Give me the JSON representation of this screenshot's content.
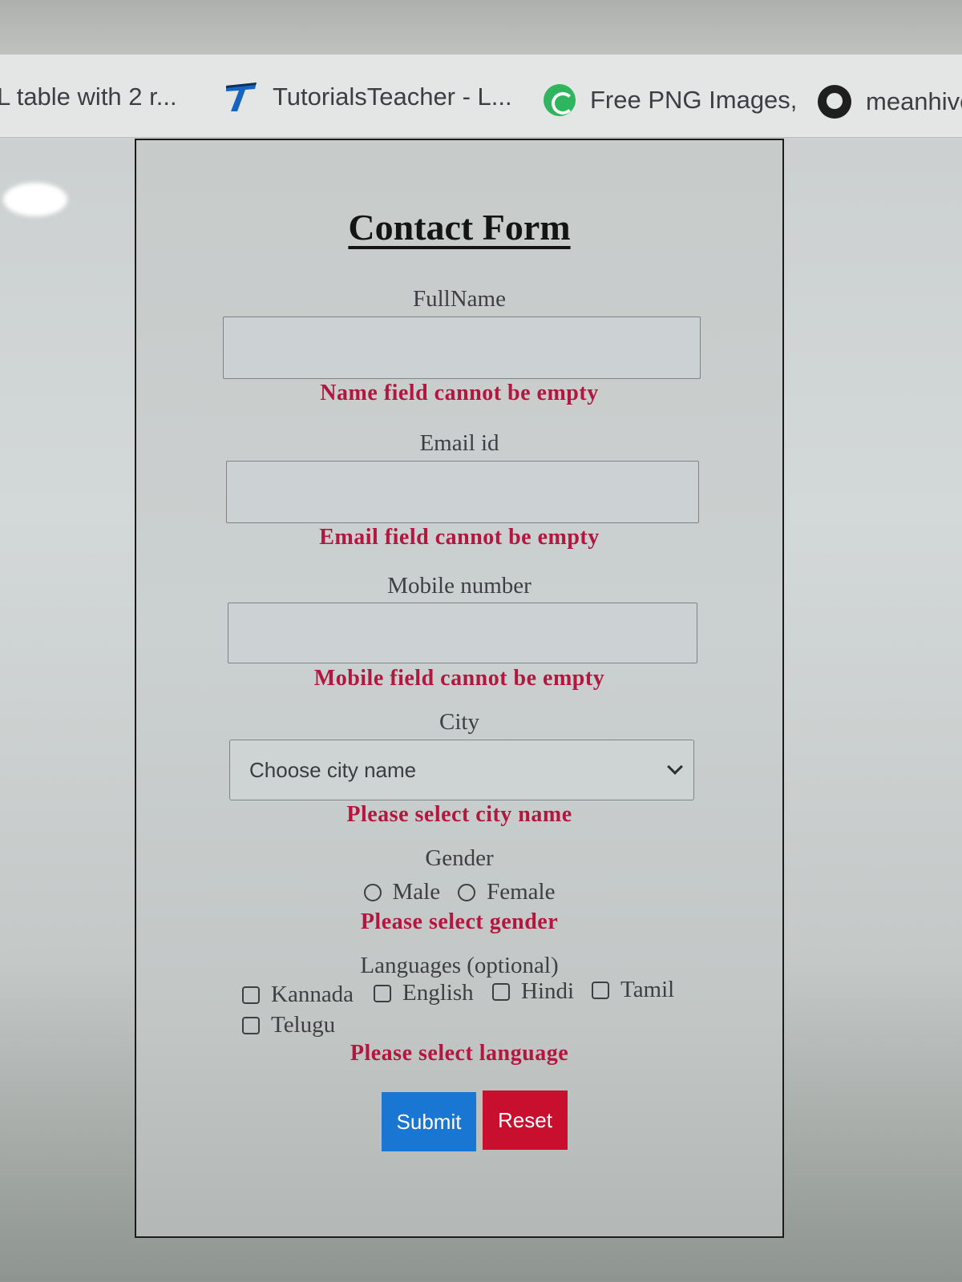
{
  "bookmarks": [
    {
      "label": "L table with 2 r...",
      "icon": "page-icon"
    },
    {
      "label": "TutorialsTeacher - L...",
      "icon": "tutorialsteacher-icon"
    },
    {
      "label": "Free PNG Images,",
      "icon": "pngimages-icon"
    },
    {
      "label": "meanhive",
      "icon": "github-icon"
    }
  ],
  "form": {
    "title": "Contact Form",
    "fullname": {
      "label": "FullName",
      "value": "",
      "error": "Name field cannot be empty"
    },
    "email": {
      "label": "Email id",
      "value": "",
      "error": "Email field cannot be empty"
    },
    "mobile": {
      "label": "Mobile number",
      "value": "",
      "error": "Mobile field cannot be empty"
    },
    "city": {
      "label": "City",
      "selected": "Choose city name",
      "error": "Please select city name"
    },
    "gender": {
      "label": "Gender",
      "options": [
        "Male",
        "Female"
      ],
      "error": "Please select gender"
    },
    "languages": {
      "label": "Languages (optional)",
      "options": [
        "Kannada",
        "English",
        "Hindi",
        "Tamil",
        "Telugu"
      ],
      "error": "Please select language"
    },
    "buttons": {
      "submit": "Submit",
      "reset": "Reset"
    }
  },
  "colors": {
    "error": "#b3163e",
    "submit": "#1976d2",
    "reset": "#c8102e",
    "tutorialsteacher_brand": "#1565c0",
    "pngimages_brand": "#2fb55d"
  }
}
